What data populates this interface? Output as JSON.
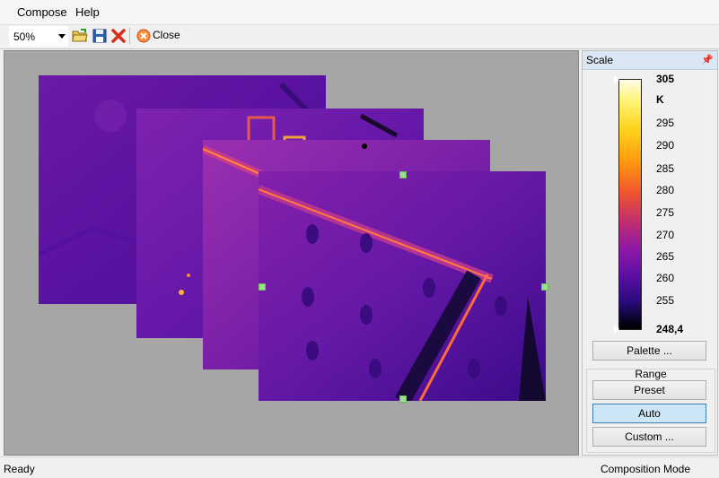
{
  "menu": {
    "items": [
      "Compose",
      "Help"
    ]
  },
  "toolbar": {
    "zoom_value": "50%",
    "close_label": "Close"
  },
  "icons": {
    "open": "open-folder-icon",
    "save": "save-icon",
    "delete": "delete-x-icon",
    "close": "close-circle-icon"
  },
  "scale": {
    "title": "Scale",
    "max": "305",
    "unit": "K",
    "ticks": [
      "295",
      "290",
      "285",
      "280",
      "275",
      "270",
      "265",
      "260",
      "255"
    ],
    "min": "248,4",
    "palette_button": "Palette ...",
    "range_label": "Range",
    "preset_button": "Preset",
    "auto_button": "Auto",
    "custom_button": "Custom ..."
  },
  "status": {
    "left": "Ready",
    "right": "Composition Mode"
  },
  "colors": {
    "canvas_bg": "#a6a6a6",
    "accent_active": "#cde6f7",
    "handle": "#9be08b"
  }
}
